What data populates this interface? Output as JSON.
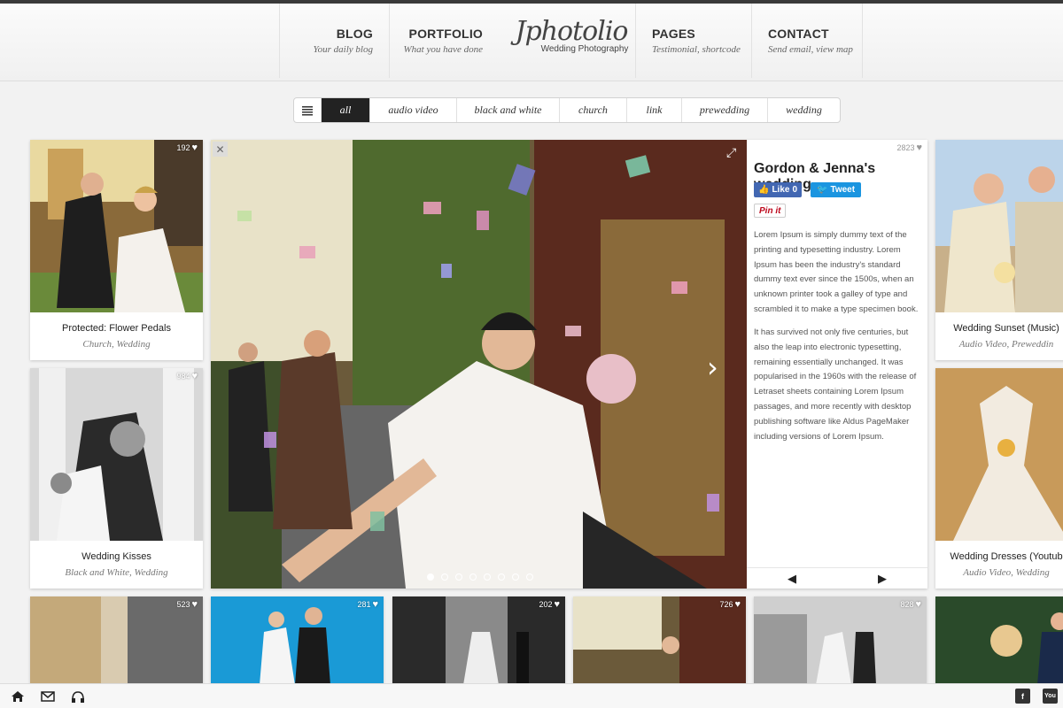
{
  "nav": {
    "blog": {
      "title": "BLOG",
      "subtitle": "Your daily blog"
    },
    "portfolio": {
      "title": "PORTFOLIO",
      "subtitle": "What you have done"
    },
    "pages": {
      "title": "PAGES",
      "subtitle": "Testimonial, shortcode"
    },
    "contact": {
      "title": "CONTACT",
      "subtitle": "Send email, view map"
    }
  },
  "logo": {
    "text": "Jphotolio",
    "tagline": "Wedding Photography"
  },
  "filters": [
    "all",
    "audio video",
    "black and white",
    "church",
    "link",
    "prewedding",
    "wedding"
  ],
  "filter_active": "all",
  "cards": {
    "flower_pedals": {
      "likes": "192",
      "title": "Protected: Flower Pedals",
      "tags": "Church, Wedding"
    },
    "wedding_kisses": {
      "likes": "984",
      "title": "Wedding Kisses",
      "tags": "Black and White, Wedding"
    },
    "wedding_sunset": {
      "title": "Wedding Sunset (Music)",
      "tags": "Audio Video, Preweddin"
    },
    "wedding_dresses": {
      "title": "Wedding Dresses (Youtub",
      "tags": "Audio Video, Wedding"
    },
    "row3": [
      {
        "likes": "523"
      },
      {
        "likes": "281"
      },
      {
        "likes": "202"
      },
      {
        "likes": "726"
      },
      {
        "likes": "828"
      },
      {
        "likes": ""
      }
    ]
  },
  "feature": {
    "likes": "2823",
    "title": "Gordon & Jenna's wedding",
    "facebook_label": "Like",
    "facebook_count": "0",
    "tweet_label": "Tweet",
    "pinit_label": "Pin it",
    "paragraph1": "Lorem Ipsum is simply dummy text of the printing and typesetting industry. Lorem Ipsum has been the industry's standard dummy text ever since the 1500s, when an unknown printer took a galley of type and scrambled it to make a type specimen book.",
    "paragraph2": "It has survived not only five centuries, but also the leap into electronic typesetting, remaining essentially unchanged. It was popularised in the 1960s with the release of Letraset sheets containing Lorem Ipsum passages, and more recently with desktop publishing software like Aldus PageMaker including versions of Lorem Ipsum.",
    "slide_count": 8,
    "active_slide": 1
  },
  "footer": {
    "icons": [
      "home-icon",
      "mail-icon",
      "headphones-icon",
      "facebook-icon",
      "youtube-icon"
    ],
    "youtube_label": "You"
  },
  "colors": {
    "accent_dark": "#222222",
    "facebook": "#4267b2",
    "twitter": "#1b95e0",
    "pinterest": "#bd081c"
  }
}
